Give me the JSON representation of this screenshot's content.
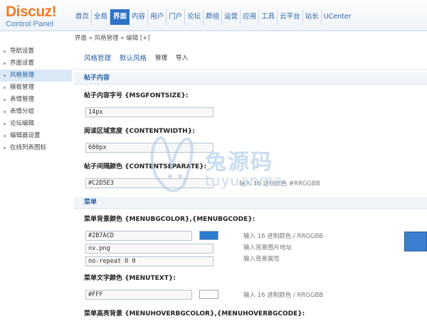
{
  "logo": {
    "main": "Discuz!",
    "sub": "Control Panel"
  },
  "nav": {
    "items": [
      "首页",
      "全局",
      "界面",
      "内容",
      "用户",
      "门户",
      "论坛",
      "群组",
      "运营",
      "应用",
      "工具",
      "云平台",
      "站长",
      "UCenter"
    ],
    "active_index": 2
  },
  "breadcrumb": "界面 » 风格管理 » 编辑 [+]",
  "sidebar": {
    "items": [
      "导航设置",
      "界面设置",
      "风格管理",
      "模板管理",
      "表情管理",
      "表情分组",
      "论坛编辑",
      "编辑器设置",
      "在线列表图标"
    ],
    "active_index": 2
  },
  "tabs": {
    "style_manage": "风格管理",
    "default_style": "默认风格",
    "manage": "管理",
    "import": "导入"
  },
  "post_section": {
    "title": "帖子内容",
    "font_label": "帖子内容字号 {MSGFONTSIZE}:",
    "font_value": "14px",
    "width_label": "阅读区域宽度 {CONTENTWIDTH}:",
    "width_value": "600px",
    "sep_label": "帖子间隔颜色 {CONTENTSEPARATE}:",
    "sep_value": "#C2D5E3",
    "sep_tip": "输入 16 进制颜色 #RRGGBB"
  },
  "menu_section": {
    "title": "菜单",
    "bg_label": "菜单背景颜色 {MENUBGCOLOR},{MENUBGCODE}:",
    "bg_color": "#2B7ACD",
    "bg_image": "nv.png",
    "bg_repeat": "no-repeat 0 0",
    "bg_tip1": "输入 16 进制颜色 / RRGGBB",
    "bg_tip2": "输入背景图片地址",
    "bg_tip3": "输入背景属性",
    "text_label": "菜单文字颜色 {MENUTEXT}:",
    "text_value": "#FFF",
    "text_tip": "输入 16 进制颜色 / RRGGBB",
    "hover_label": "菜单高亮背景 {MENUHOVERBGCOLOR},{MENUHOVERBGCODE}:"
  },
  "watermark": {
    "title": "兔源码",
    "sub": "tuyuanma"
  },
  "colors": {
    "accent": "#2f72c7",
    "logo": "#f47b20",
    "menu_bg": "#2B7ACD",
    "menu_text": "#FFFFFF"
  }
}
